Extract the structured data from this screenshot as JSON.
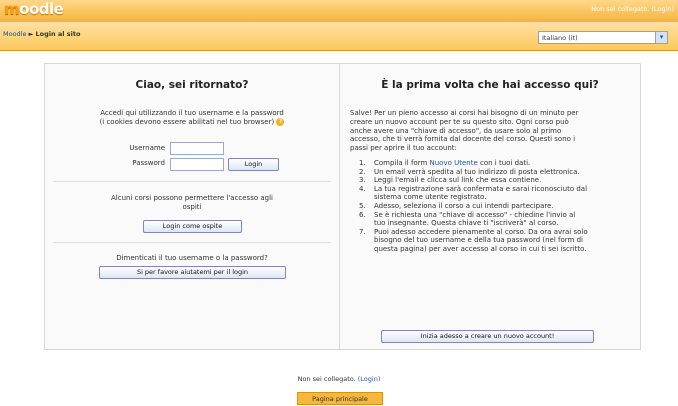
{
  "header": {
    "logo_prefix": "m",
    "logo_rest": "oodle",
    "login_status": "Non sei collegato.",
    "login_link": "(Login)"
  },
  "navbar": {
    "home_link": "Moodle",
    "separator": "►",
    "current": "Login al sito",
    "language": "Italiano (it)"
  },
  "left": {
    "title": "Ciao, sei ritornato?",
    "intro_line1": "Accedi qui utilizzando il tuo username e la password",
    "intro_line2": "(i cookies devono essere abilitati nel tuo browser)",
    "username_label": "Username",
    "password_label": "Password",
    "username_value": "",
    "password_value": "",
    "login_button": "Login",
    "guest_line1": "Alcuni corsi possono permettere l'accesso agli",
    "guest_line2": "ospiti",
    "guest_button": "Login come ospite",
    "forgot_text": "Dimenticati il tuo username o la password?",
    "forgot_button": "Si per favore aiutatemi per il login"
  },
  "right": {
    "title": "È la prima volta che hai accesso qui?",
    "intro": [
      "Salve! Per un pieno accesso ai corsi hai bisogno di un minuto per",
      "creare un nuovo account per te su questo sito. Ogni corso può",
      "anche avere una \"chiave di accesso\", da usare solo al primo",
      "accesso, che ti verrà fornita dal docente del corso. Questi sono i",
      "passi per aprire il tuo account:"
    ],
    "step1_pre": "Compila il form ",
    "step1_link": "Nuovo Utente",
    "step1_post": " con i tuoi dati.",
    "steps": [
      {
        "n": "2.",
        "lines": [
          "Un email verrà spedita al tuo indirizzo di posta elettronica."
        ]
      },
      {
        "n": "3.",
        "lines": [
          "Leggi l'email e clicca sul link che essa contiene."
        ]
      },
      {
        "n": "4.",
        "lines": [
          "La tua registrazione sarà confermata e sarai riconosciuto dal",
          "sistema come utente registrato."
        ]
      },
      {
        "n": "5.",
        "lines": [
          "Adesso, seleziona il corso a cui intendi partecipare."
        ]
      },
      {
        "n": "6.",
        "lines": [
          "Se è richiesta una \"chiave di accesso\" - chiedine l'invio al",
          "tuo insegnante. Questa chiave ti \"iscriverà\" al corso."
        ]
      },
      {
        "n": "7.",
        "lines": [
          "Puoi adesso accedere pienamente al corso. Da ora avrai solo",
          "bisogno del tuo username e della tua password (nel form di",
          "questa pagina) per aver accesso al corso in cui ti sei iscritto."
        ]
      }
    ],
    "signup_button": "Inizia adesso a creare un nuovo account!"
  },
  "footer": {
    "status": "Non sei collegato.",
    "login_link": "(Login)",
    "home_button": "Pagina principale"
  }
}
